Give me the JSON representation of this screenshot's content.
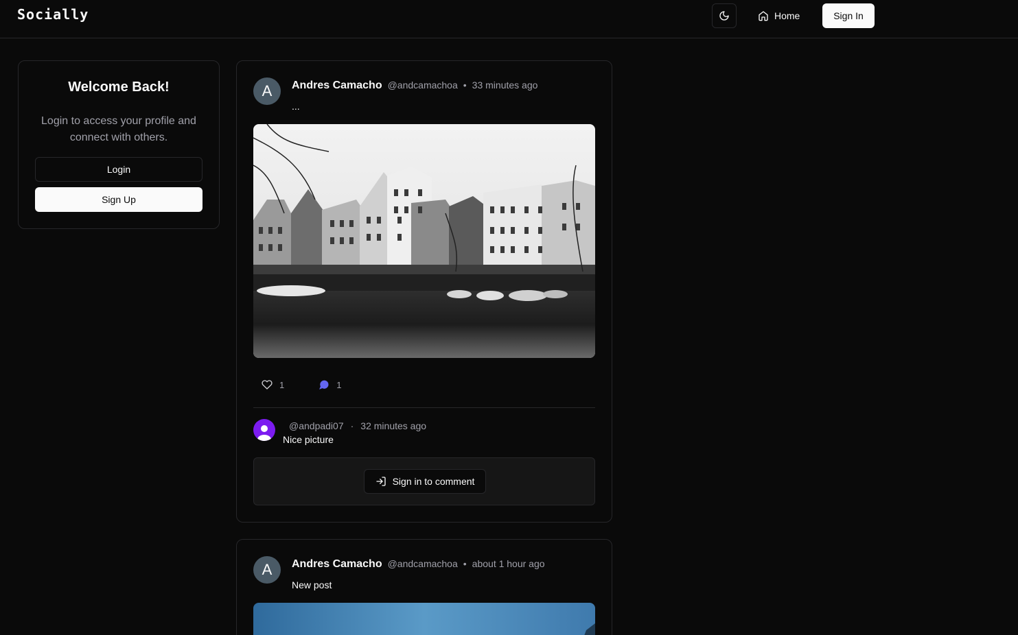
{
  "header": {
    "logo": "Socially",
    "home_label": "Home",
    "signin_label": "Sign In",
    "theme_icon": "moon-icon"
  },
  "sidebar": {
    "title": "Welcome Back!",
    "description": "Login to access your profile and connect with others.",
    "login_label": "Login",
    "signup_label": "Sign Up"
  },
  "posts": [
    {
      "avatar_letter": "A",
      "author": "Andres Camacho",
      "handle": "@andcamachoa",
      "separator": "•",
      "time": "33 minutes ago",
      "text": "...",
      "image_desc": "black-and-white canal with boats and townhouses",
      "likes": "1",
      "comments_count": "1",
      "comment": {
        "handle": "@andpadi07",
        "separator": "·",
        "time": "32 minutes ago",
        "text": "Nice picture"
      },
      "signin_comment_label": "Sign in to comment"
    },
    {
      "avatar_letter": "A",
      "author": "Andres Camacho",
      "handle": "@andcamachoa",
      "separator": "•",
      "time": "about 1 hour ago",
      "text": "New post"
    }
  ],
  "colors": {
    "background": "#0a0a0a",
    "border": "#27272a",
    "muted_text": "#a1a1aa",
    "comment_icon": "#6366f1",
    "comment_avatar": "#7c1cf0"
  }
}
